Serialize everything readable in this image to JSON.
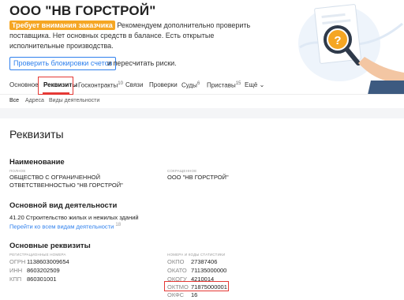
{
  "company": {
    "title": "ООО \"НВ ГОРСТРОЙ\""
  },
  "warning": {
    "badge": "Требует внимания заказчика",
    "text": "Рекомендуем дополнительно проверить поставщика. Нет основных средств в балансе. Есть открытые исполнительные производства."
  },
  "check": {
    "button": "Проверить блокировки счетов",
    "tail": "и пересчитать риски."
  },
  "tabs": [
    {
      "label": "Основное",
      "count": ""
    },
    {
      "label": "Реквизиты",
      "count": ""
    },
    {
      "label": "Госконтракты",
      "count": "10"
    },
    {
      "label": "Связи",
      "count": ""
    },
    {
      "label": "Проверки",
      "count": ""
    },
    {
      "label": "Суды",
      "count": "6"
    },
    {
      "label": "Приставы",
      "count": "15"
    },
    {
      "label": "Ещё",
      "count": ""
    }
  ],
  "subtabs": [
    "Все",
    "Адреса",
    "Виды деятельности"
  ],
  "section_title": "Реквизиты",
  "naming": {
    "title": "Наименование",
    "full_label": "полное",
    "full_value": "ОБЩЕСТВО С ОГРАНИЧЕННОЙ ОТВЕТСТВЕННОСТЬЮ \"НВ ГОРСТРОЙ\"",
    "short_label": "сокращенное",
    "short_value": "ООО \"НВ ГОРСТРОЙ\""
  },
  "activity": {
    "title": "Основной вид деятельности",
    "value": "41.20 Строительство жилых и нежилых зданий",
    "link": "Перейти ко всем видам деятельности",
    "link_count": "18"
  },
  "requisites": {
    "title": "Основные реквизиты",
    "reg_label": "регистрационные номера",
    "stat_label": "номера и коды статистики",
    "reg": [
      {
        "k": "ОГРН",
        "v": "1138603009654"
      },
      {
        "k": "ИНН",
        "v": "8603202509"
      },
      {
        "k": "КПП",
        "v": "860301001"
      }
    ],
    "stat": [
      {
        "k": "ОКПО",
        "v": "27387406"
      },
      {
        "k": "ОКАТО",
        "v": "71135000000"
      },
      {
        "k": "ОКОГУ",
        "v": "4210014"
      },
      {
        "k": "ОКТМО",
        "v": "71875000001"
      },
      {
        "k": "ОКФС",
        "v": "16"
      }
    ]
  },
  "colors": {
    "accent": "#2f80ed",
    "warning": "#f5a623",
    "highlight": "#e53935"
  },
  "icons": [
    "question-mark-icon",
    "magnifier-icon",
    "chevron-down-icon"
  ]
}
